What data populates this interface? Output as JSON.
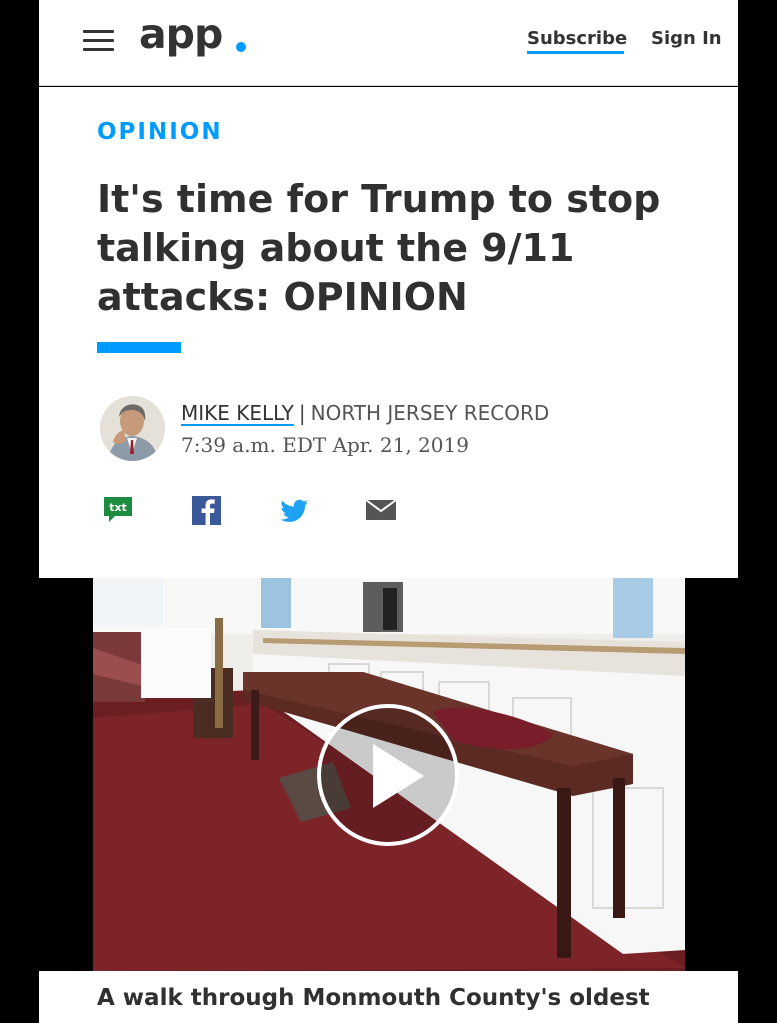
{
  "header": {
    "menu_icon": "hamburger-menu-icon",
    "logo_text": "app",
    "logo_dot_color": "#009bff",
    "subscribe_label": "Subscribe",
    "signin_label": "Sign In"
  },
  "article": {
    "section": "OPINION",
    "headline": "It's time for Trump to stop talking about the 9/11 attacks: OPINION",
    "author": "MIKE KELLY",
    "separator": "|",
    "outlet": "NORTH JERSEY RECORD",
    "timestamp": "7:39 a.m. EDT Apr. 21, 2019",
    "accent_color": "#009bff"
  },
  "share": [
    {
      "icon": "txt-message-icon",
      "label": "txt",
      "color": "#1c8d3f"
    },
    {
      "icon": "facebook-icon",
      "color": "#3b5998"
    },
    {
      "icon": "twitter-icon",
      "color": "#1da1f2"
    },
    {
      "icon": "email-icon",
      "color": "#555555"
    }
  ],
  "video": {
    "play_icon": "play-icon",
    "caption": "A walk through Monmouth County's oldest"
  }
}
